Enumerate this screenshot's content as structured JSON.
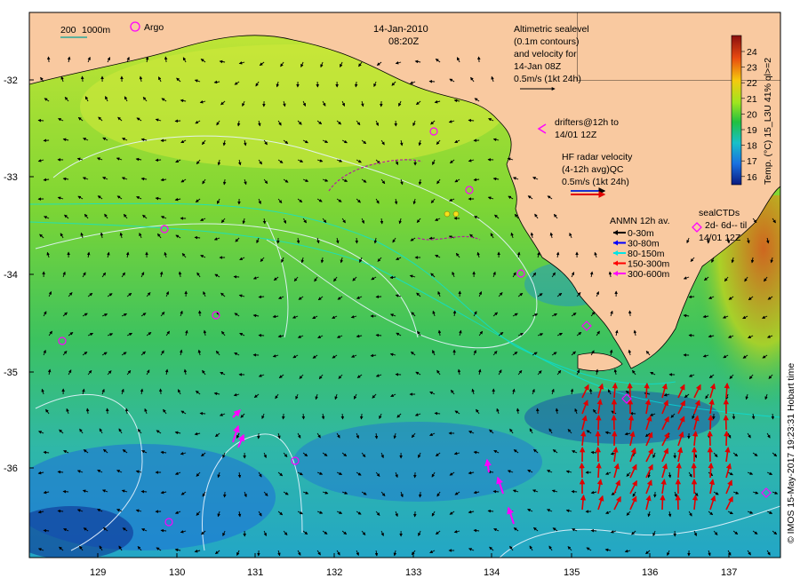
{
  "date_title": "14-Jan-2010",
  "time_title": "08:20Z",
  "scale_legend": {
    "label_a": "200",
    "label_b": "1000m",
    "argo": "Argo"
  },
  "altimetry_note": [
    "Altimetric sealevel",
    "(0.1m contours)",
    "and velocity for",
    "14-Jan 08Z",
    "0.5m/s (1kt 24h)"
  ],
  "drifters_note": [
    "drifters@12h to",
    "14/01 12Z"
  ],
  "hf_radar_note": [
    "HF radar velocity",
    "(4-12h avg)QC",
    "0.5m/s (1kt 24h)"
  ],
  "anmn": {
    "title": "ANMN 12h av.",
    "items": [
      {
        "label": "0-30m",
        "color": "#000000"
      },
      {
        "label": "30-80m",
        "color": "#0000ff"
      },
      {
        "label": "80-150m",
        "color": "#00e5e5"
      },
      {
        "label": "150-300m",
        "color": "#ff0000"
      },
      {
        "label": "300-600m",
        "color": "#ff00ff"
      }
    ]
  },
  "sealctd": {
    "title": "sealCTDs",
    "line1": "2d- 6d-- til",
    "line2": "14/01 12Z"
  },
  "colorbar": {
    "ticks": [
      "24",
      "23",
      "22",
      "21",
      "20",
      "19",
      "18",
      "17",
      "16"
    ],
    "title": "Temp. (°C) 15_L3U 41% ql>=2"
  },
  "credit": "© IMOS 15-May-2017 19:23:31 Hobart time",
  "y_ticks": [
    "-32",
    "-33",
    "-34",
    "-35",
    "-36"
  ],
  "x_ticks": [
    "129",
    "130",
    "131",
    "132",
    "133",
    "134",
    "135",
    "136",
    "137"
  ],
  "colors": {
    "land": "#f9c9a0",
    "drifter": "#ff00ff",
    "hf_radar": "#e00000",
    "contour": "#e8f4ff"
  }
}
